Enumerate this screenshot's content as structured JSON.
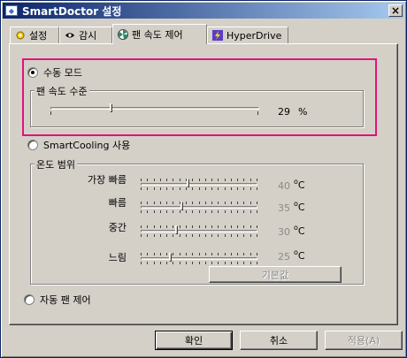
{
  "window": {
    "title": "SmartDoctor 설정"
  },
  "tabs": [
    {
      "label": "설정",
      "icon": "gear-icon"
    },
    {
      "label": "감시",
      "icon": "eye-icon"
    },
    {
      "label": "팬 속도 제어",
      "icon": "fan-icon"
    },
    {
      "label": "HyperDrive",
      "icon": "lightning-icon"
    }
  ],
  "active_tab": "팬 속도 제어",
  "manual_mode": {
    "radio_label": "수동 모드",
    "selected": true,
    "group_label": "팬 속도 수준",
    "value": "29",
    "unit": "%",
    "fraction": 0.29
  },
  "smartcooling": {
    "radio_label": "SmartCooling 사용",
    "selected": false,
    "group_label": "온도 범위",
    "rows": [
      {
        "label": "가장 빠름",
        "value": "40",
        "fraction": 0.4
      },
      {
        "label": "빠름",
        "value": "35",
        "fraction": 0.35
      },
      {
        "label": "중간",
        "value": "30",
        "fraction": 0.3
      },
      {
        "label": "느림",
        "value": "25",
        "fraction": 0.25
      }
    ],
    "unit": "C",
    "default_button": "기본값"
  },
  "auto_control": {
    "radio_label": "자동 팬 제어",
    "selected": false
  },
  "buttons": {
    "ok": "확인",
    "cancel": "취소",
    "apply": "적용(A)"
  },
  "colors": {
    "highlight": "#e0137a",
    "titlebar_start": "#0a246a",
    "titlebar_end": "#a6caf0"
  }
}
